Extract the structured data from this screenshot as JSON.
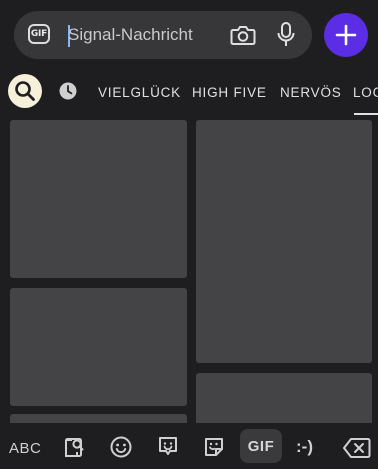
{
  "composer": {
    "gif_badge": "GIF",
    "placeholder": "Signal-Nachricht"
  },
  "tabs": {
    "items": [
      {
        "label": "VIELGLÜCK"
      },
      {
        "label": "HIGH FIVE"
      },
      {
        "label": "NERVÖS"
      },
      {
        "label": "LOG"
      }
    ]
  },
  "keyboard": {
    "abc_label": "ABC",
    "gif_label": "GIF",
    "emoticon_label": ":-)"
  },
  "colors": {
    "background": "#1e1e20",
    "composer": "#37373a",
    "accent": "#5b2ee6",
    "search_circle": "#f6efd9",
    "tile": "#444446"
  }
}
